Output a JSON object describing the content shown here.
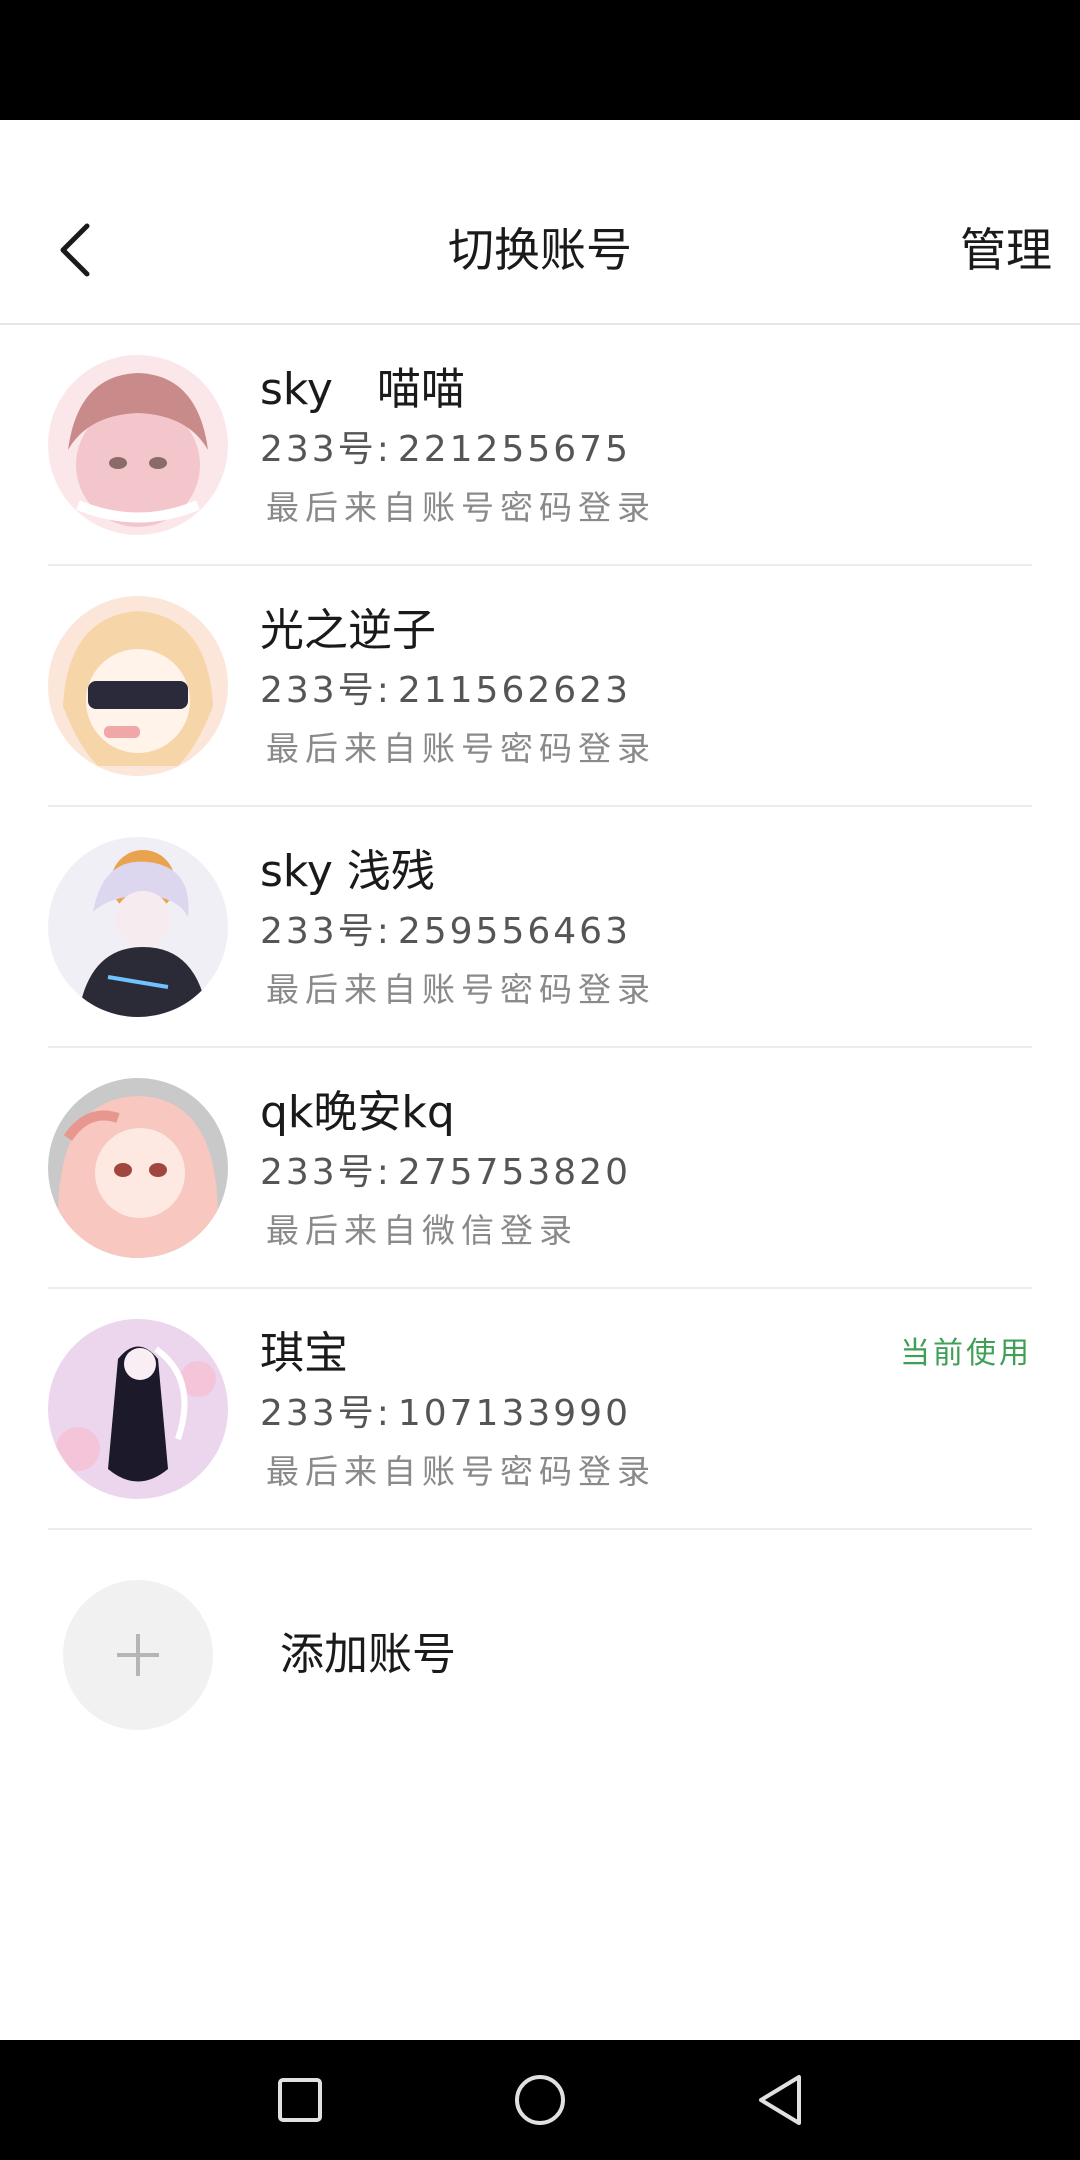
{
  "header": {
    "title": "切换账号",
    "manage_label": "管理"
  },
  "accounts": [
    {
      "name": "sky　喵喵",
      "id_label": "233号:",
      "id_value": "221255675",
      "login_method": "最后来自账号密码登录",
      "current": false,
      "avatar_colors": [
        "#f3c6cc",
        "#c98a8a",
        "#fbe7ea"
      ]
    },
    {
      "name": "光之逆子",
      "id_label": "233号:",
      "id_value": "211562623",
      "login_method": "最后来自账号密码登录",
      "current": false,
      "avatar_colors": [
        "#fbe6d9",
        "#f6d5a8",
        "#2a2a3a"
      ]
    },
    {
      "name": "sky 浅残",
      "id_label": "233号:",
      "id_value": "259556463",
      "login_method": "最后来自账号密码登录",
      "current": false,
      "avatar_colors": [
        "#dcd6ee",
        "#6d6a8c",
        "#2b2b38"
      ]
    },
    {
      "name": "qk晚安kq",
      "id_label": "233号:",
      "id_value": "275753820",
      "login_method": "最后来自微信登录",
      "current": false,
      "avatar_colors": [
        "#f7c7c0",
        "#e8978f",
        "#c9c9c9"
      ]
    },
    {
      "name": "琪宝",
      "id_label": "233号:",
      "id_value": "107133990",
      "login_method": "最后来自账号密码登录",
      "current": true,
      "current_label": "当前使用",
      "avatar_colors": [
        "#ecd6ee",
        "#1c1a2a",
        "#f4c5d8"
      ]
    }
  ],
  "add_account": {
    "label": "添加账号",
    "icon": "plus-icon"
  },
  "nav": {
    "icons": [
      "recents-square-icon",
      "home-circle-icon",
      "back-triangle-icon"
    ]
  },
  "colors": {
    "accent_current": "#3f9f56",
    "text_primary": "#1a1a1a",
    "text_secondary": "#555555",
    "text_muted": "#8a8a8a",
    "divider": "#ececec"
  }
}
